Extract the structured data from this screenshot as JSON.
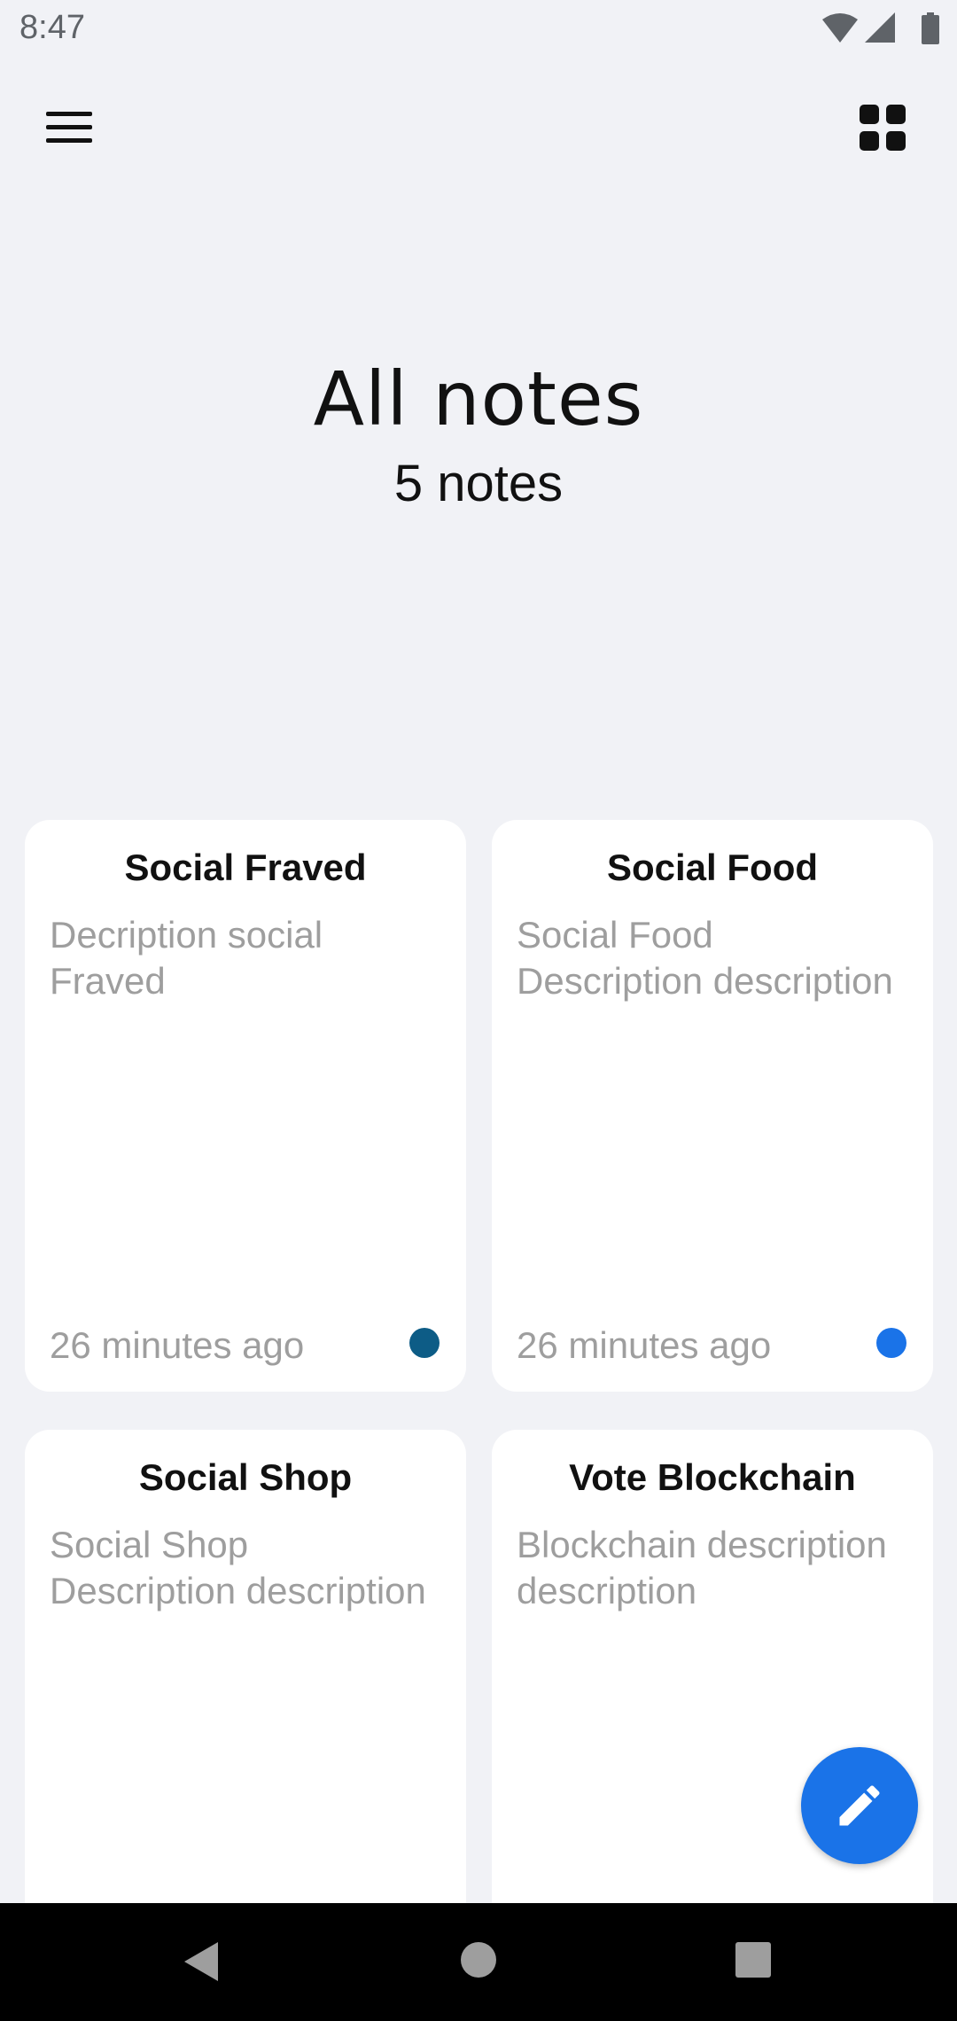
{
  "status_bar": {
    "time": "8:47",
    "icons": [
      "wifi-icon",
      "signal-icon",
      "battery-icon"
    ]
  },
  "top_bar": {
    "menu_icon": "hamburger-menu-icon",
    "view_toggle_icon": "grid-view-icon"
  },
  "header": {
    "title": "All notes",
    "count": "5 notes"
  },
  "notes": [
    {
      "title": "Social Fraved",
      "description": "Decription social Fraved",
      "time": "26 minutes ago",
      "color": "#0d5c86"
    },
    {
      "title": "Social Food",
      "description": "Social Food Description description",
      "time": "26 minutes ago",
      "color": "#1a73e8"
    },
    {
      "title": "Social Shop",
      "description": "Social Shop Description description"
    },
    {
      "title": "Vote Blockchain",
      "description": "Blockchain description description"
    }
  ],
  "fab": {
    "icon": "pencil-icon",
    "color": "#1a73e8"
  },
  "nav_bar": {
    "icons": [
      "back-icon",
      "home-icon",
      "recents-icon"
    ]
  }
}
